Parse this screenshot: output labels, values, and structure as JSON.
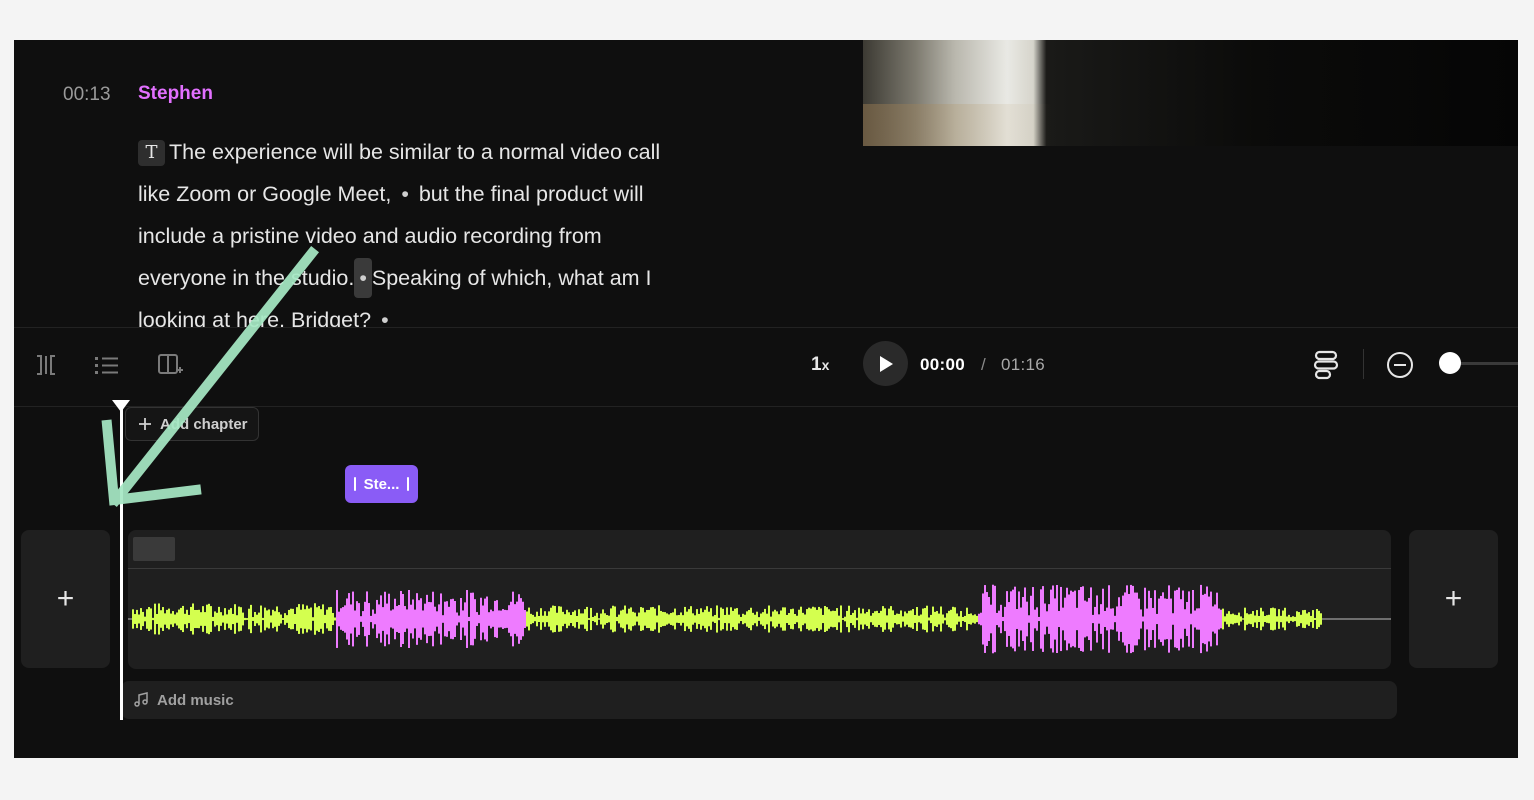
{
  "transcript": {
    "timestamp": "00:13",
    "speaker": "Stephen",
    "chip": "T",
    "line1": "The experience will be similar to a normal video call",
    "line2a": "like Zoom or Google Meet,",
    "line2b": "but the final product will",
    "line3": "include a pristine video and audio recording from",
    "line4a": "everyone in the studio.",
    "line4b": "Speaking of which, what am I",
    "line5": "looking at here, Bridget?",
    "dot": "•"
  },
  "playback": {
    "speed": "1",
    "speed_suffix": "x",
    "current_time": "00:00",
    "separator": "/",
    "total_time": "01:16"
  },
  "timeline": {
    "add_chapter": "Add chapter",
    "speaker_clip": "Ste...",
    "add_music": "Add music",
    "add_left": "+",
    "add_right": "+"
  },
  "colors": {
    "speaker": "#e270ff",
    "wave_green": "#d4ff4f",
    "wave_pink": "#ee7bff",
    "clip": "#8a5cf6",
    "arrow": "#a6e8c4"
  },
  "icons": [
    "split-icon",
    "list-icon",
    "add-layout-icon",
    "play-icon",
    "captions-icon",
    "zoom-out-icon",
    "plus-icon",
    "music-icon"
  ]
}
